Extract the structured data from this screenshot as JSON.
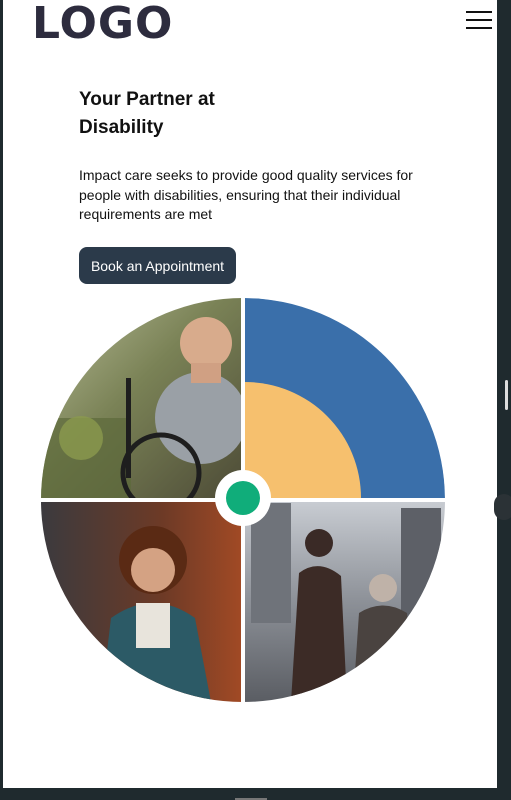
{
  "header": {
    "logo_text": "LOGO",
    "menu_icon": "hamburger-menu-icon"
  },
  "hero": {
    "title_line1": "Your Partner at",
    "title_line2": "Disability",
    "description": "Impact care seeks to provide good quality services for people with disabilities, ensuring that their individual requirements are met",
    "cta_label": "Book an Appointment"
  },
  "collage": {
    "quadrants": [
      {
        "position": "top-left",
        "content": "photo"
      },
      {
        "position": "top-right",
        "content": "graphic"
      },
      {
        "position": "bottom-left",
        "content": "photo"
      },
      {
        "position": "bottom-right",
        "content": "photo"
      }
    ],
    "colors": {
      "blue": "#3a6faa",
      "yellow": "#f6c06e",
      "green_dot": "#10ad7a",
      "dark_button": "#2b3a4a",
      "logo": "#2d2c3e"
    }
  }
}
